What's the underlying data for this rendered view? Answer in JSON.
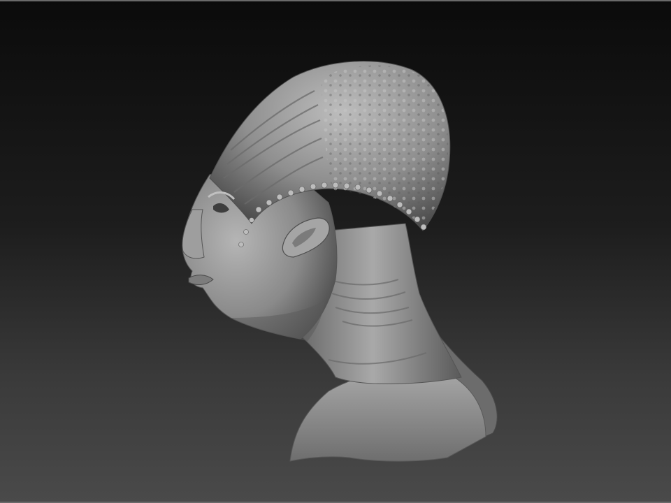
{
  "viewport": {
    "background_top": "#0b0b0b",
    "background_bottom": "#4a4a4a",
    "frame_color": "#6a6a6a"
  },
  "model": {
    "kind": "sculpted-head-bust",
    "material_color": "#9a9a9a",
    "highlight_color": "#c8c8c8",
    "shadow_color": "#4e4e4e"
  }
}
